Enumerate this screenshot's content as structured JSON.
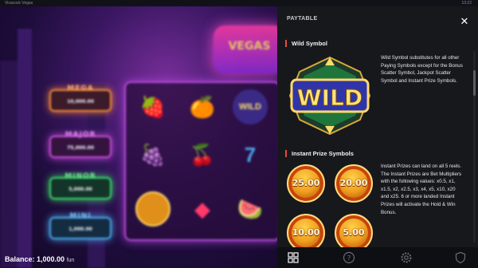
{
  "window": {
    "title": "Vivacock Vegas",
    "clock": "13:22"
  },
  "game": {
    "logo_text": "VEGAS",
    "jackpots": [
      {
        "name": "MEGA",
        "value": "10,000.00"
      },
      {
        "name": "MAJOR",
        "value": "75,000.00"
      },
      {
        "name": "MINOR",
        "value": "5,000.00"
      },
      {
        "name": "MINI",
        "value": "1,000.00"
      }
    ],
    "balance_label": "Balance: 1,000.00",
    "balance_currency": "fun"
  },
  "paytable": {
    "title": "PAYTABLE",
    "close_icon": "close-icon",
    "wild": {
      "heading": "Wild Symbol",
      "badge_text": "WILD",
      "description": "Wild Symbol substitutes for all other Paying Symbols except for the Bonus Scatter Symbol, Jackpot Scatter Symbol and Instant Prize Symbols."
    },
    "instant": {
      "heading": "Instant Prize Symbols",
      "description": "Instant Prizes can land on all 5 reels. The Instant Prizes are Bet Multipliers with the following values: x0.5, x1, x1.5, x2, x2.5, x3, x4, x5, x10, x20 and x25. 6 or more landed Instant Prizes will activate the Hold & Win Bonus.",
      "coins": [
        "25.00",
        "20.00",
        "10.00",
        "5.00"
      ]
    }
  },
  "bottom_nav": [
    {
      "name": "paytable-tab",
      "icon": "grid-icon"
    },
    {
      "name": "help-tab",
      "icon": "question-icon"
    },
    {
      "name": "settings-tab",
      "icon": "gear-icon"
    },
    {
      "name": "history-tab",
      "icon": "shield-icon"
    }
  ],
  "colors": {
    "panel_bg": "#17181c",
    "accent": "#e84a3c",
    "coin_gold": "#f0a020"
  }
}
